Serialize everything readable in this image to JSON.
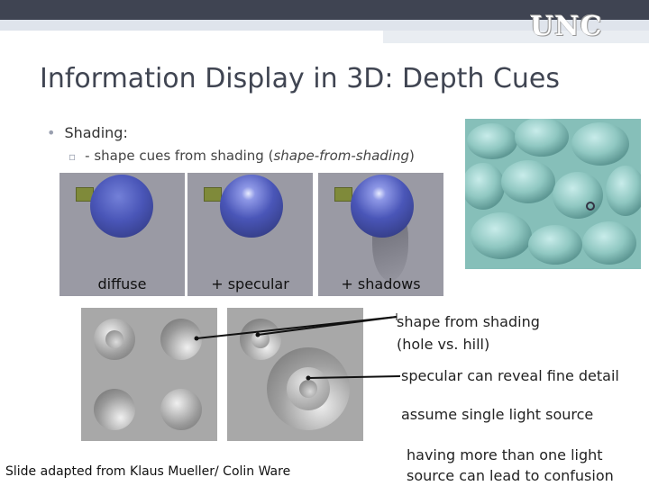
{
  "header": {
    "logo_text": "UNC"
  },
  "slide": {
    "title": "Information Display in 3D: Depth Cues",
    "bullet_1": "Shading:",
    "bullet_2_plain": "- shape cues from shading (",
    "bullet_2_italic": "shape-from-shading",
    "bullet_2_close": ")"
  },
  "panels": [
    {
      "label": "diffuse"
    },
    {
      "label": "+ specular"
    },
    {
      "label": "+ shadows"
    }
  ],
  "notes": {
    "shape_line1": "shape from shading",
    "shape_line2": "(hole vs. hill)",
    "specular": "specular can reveal fine detail",
    "light": "assume single light source",
    "confusion_line1": "having more than one light",
    "confusion_line2": "source can lead to confusion"
  },
  "footer": {
    "credit": "Slide adapted from Klaus Mueller/ Colin Ware"
  },
  "colors": {
    "title": "#404552",
    "topbar": "#3f4452",
    "sphere": "#4a56b8",
    "photo": "#8fc7c1"
  }
}
